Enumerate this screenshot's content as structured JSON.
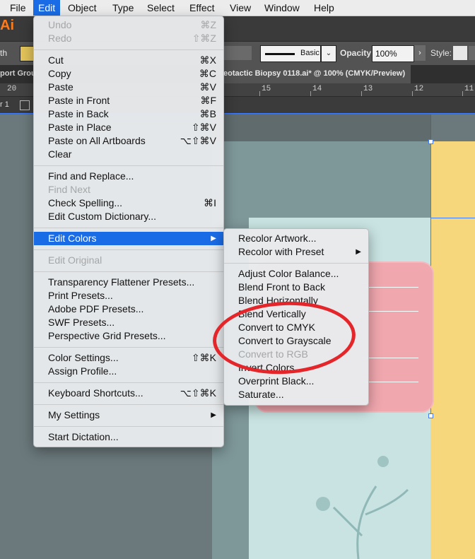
{
  "menubar": {
    "items": [
      "File",
      "Edit",
      "Object",
      "Type",
      "Select",
      "Effect",
      "View",
      "Window",
      "Help"
    ],
    "active": "Edit"
  },
  "app": {
    "logo": "Ai",
    "stroke_style": "Basic",
    "opacity_label": "Opacity:",
    "opacity_value": "100%",
    "style_label": "Style:",
    "left_clip_1": "th",
    "tab_left": "port Grou",
    "tab_title": "eotactic Biopsy 0118.ai* @ 100% (CMYK/Preview)",
    "layer_label": "r 1",
    "ruler_ticks": [
      "20",
      "15",
      "14",
      "13",
      "12",
      "11"
    ]
  },
  "edit_menu": {
    "items": [
      {
        "label": "Undo",
        "shortcut": "⌘Z",
        "disabled": true
      },
      {
        "label": "Redo",
        "shortcut": "⇧⌘Z",
        "disabled": true
      },
      {
        "sep": true
      },
      {
        "label": "Cut",
        "shortcut": "⌘X"
      },
      {
        "label": "Copy",
        "shortcut": "⌘C"
      },
      {
        "label": "Paste",
        "shortcut": "⌘V"
      },
      {
        "label": "Paste in Front",
        "shortcut": "⌘F"
      },
      {
        "label": "Paste in Back",
        "shortcut": "⌘B"
      },
      {
        "label": "Paste in Place",
        "shortcut": "⇧⌘V"
      },
      {
        "label": "Paste on All Artboards",
        "shortcut": "⌥⇧⌘V"
      },
      {
        "label": "Clear",
        "shortcut": ""
      },
      {
        "sep": true
      },
      {
        "label": "Find and Replace...",
        "shortcut": ""
      },
      {
        "label": "Find Next",
        "shortcut": "",
        "disabled": true
      },
      {
        "label": "Check Spelling...",
        "shortcut": "⌘I"
      },
      {
        "label": "Edit Custom Dictionary...",
        "shortcut": ""
      },
      {
        "sep": true
      },
      {
        "label": "Edit Colors",
        "shortcut": "▶",
        "highlighted": true
      },
      {
        "sep": true
      },
      {
        "label": "Edit Original",
        "shortcut": "",
        "disabled": true
      },
      {
        "sep": true
      },
      {
        "label": "Transparency Flattener Presets...",
        "shortcut": ""
      },
      {
        "label": "Print Presets...",
        "shortcut": ""
      },
      {
        "label": "Adobe PDF Presets...",
        "shortcut": ""
      },
      {
        "label": "SWF Presets...",
        "shortcut": ""
      },
      {
        "label": "Perspective Grid Presets...",
        "shortcut": ""
      },
      {
        "sep": true
      },
      {
        "label": "Color Settings...",
        "shortcut": "⇧⌘K"
      },
      {
        "label": "Assign Profile...",
        "shortcut": ""
      },
      {
        "sep": true
      },
      {
        "label": "Keyboard Shortcuts...",
        "shortcut": "⌥⇧⌘K"
      },
      {
        "sep": true
      },
      {
        "label": "My Settings",
        "shortcut": "▶"
      },
      {
        "sep": true
      },
      {
        "label": "Start Dictation...",
        "shortcut": ""
      }
    ]
  },
  "colors_submenu": {
    "items": [
      {
        "label": "Recolor Artwork...",
        "shortcut": ""
      },
      {
        "label": "Recolor with Preset",
        "shortcut": "▶"
      },
      {
        "sep": true
      },
      {
        "label": "Adjust Color Balance...",
        "shortcut": ""
      },
      {
        "label": "Blend Front to Back",
        "shortcut": ""
      },
      {
        "label": "Blend Horizontally",
        "shortcut": ""
      },
      {
        "label": "Blend Vertically",
        "shortcut": ""
      },
      {
        "label": "Convert to CMYK",
        "shortcut": ""
      },
      {
        "label": "Convert to Grayscale",
        "shortcut": ""
      },
      {
        "label": "Convert to RGB",
        "shortcut": "",
        "disabled": true
      },
      {
        "label": "Invert Colors",
        "shortcut": ""
      },
      {
        "label": "Overprint Black...",
        "shortcut": ""
      },
      {
        "label": "Saturate...",
        "shortcut": ""
      }
    ]
  },
  "colors": {
    "accent": "#1a6ce6",
    "annotation_circle": "#e4262b"
  }
}
